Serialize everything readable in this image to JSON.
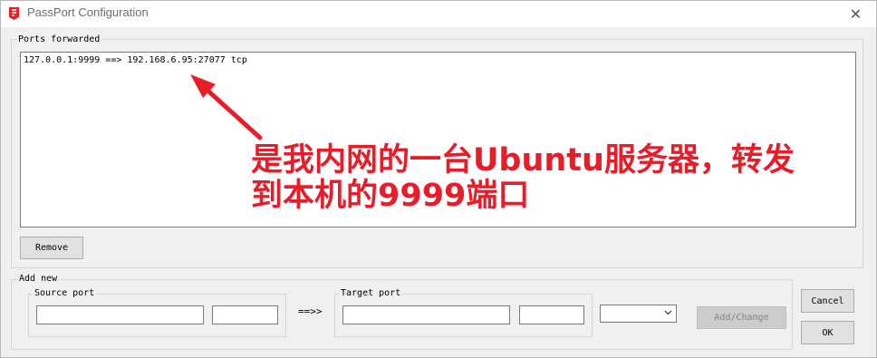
{
  "window": {
    "title": "PassPort Configuration",
    "close_glyph": "✕"
  },
  "ports_forwarded": {
    "label": "Ports forwarded",
    "items": [
      "127.0.0.1:9999 ==> 192.168.6.95:27077 tcp"
    ],
    "remove_label": "Remove"
  },
  "annotation": {
    "line1": "是我内网的一台Ubuntu服务器，转发",
    "line2": "到本机的9999端口",
    "color": "#e81d2a"
  },
  "add_new": {
    "label": "Add new",
    "source_label": "Source port",
    "source_host_value": "",
    "source_port_value": "",
    "arrow_text": "==>>",
    "target_label": "Target port",
    "target_host_value": "",
    "target_port_value": "",
    "protocol_value": "",
    "add_change_label": "Add/Change"
  },
  "buttons": {
    "cancel_label": "Cancel",
    "ok_label": "OK"
  },
  "icons": {
    "app_icon": "passport-app-icon",
    "close_icon": "close-icon",
    "dropdown_icon": "chevron-down-icon"
  }
}
